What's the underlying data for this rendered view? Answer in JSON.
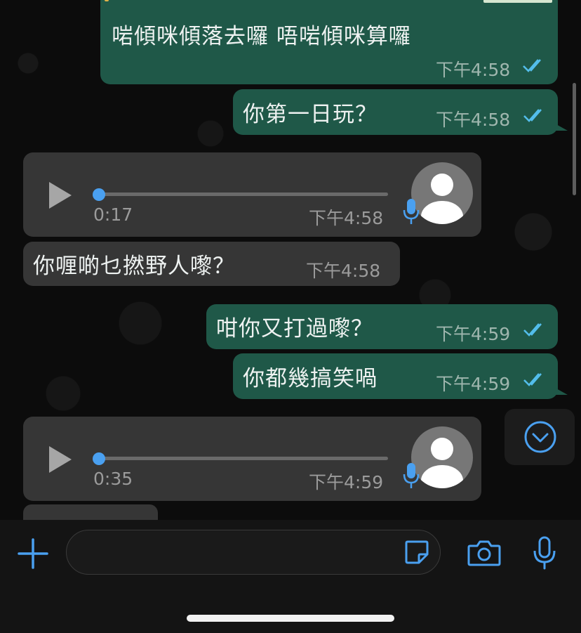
{
  "colors": {
    "outgoing_bubble": "#1f5848",
    "incoming_bubble": "#363636",
    "accent_blue": "#4aa0f0",
    "read_ticks": "#53bdeb"
  },
  "messages": [
    {
      "direction": "outgoing",
      "text": "啱傾咪傾落去囉 唔啱傾咪算囉",
      "time": "下午4:58",
      "status": "read"
    },
    {
      "direction": "outgoing",
      "text": "你第一日玩？",
      "time": "下午4:58",
      "status": "read"
    },
    {
      "direction": "incoming",
      "type": "voice",
      "duration": "0:17",
      "time": "下午4:58"
    },
    {
      "direction": "incoming",
      "text": "你喱啲乜撚野人嚟？",
      "time": "下午4:58"
    },
    {
      "direction": "outgoing",
      "text": "咁你又打過嚟？",
      "time": "下午4:59",
      "status": "read"
    },
    {
      "direction": "outgoing",
      "text": "你都幾搞笑喎",
      "time": "下午4:59",
      "status": "read"
    },
    {
      "direction": "incoming",
      "type": "voice",
      "duration": "0:35",
      "time": "下午4:59"
    }
  ],
  "icons": {
    "scroll_down": "chevron-down-circle-icon",
    "attach": "plus-icon",
    "sticker": "sticker-icon",
    "camera": "camera-icon",
    "mic": "microphone-icon"
  }
}
